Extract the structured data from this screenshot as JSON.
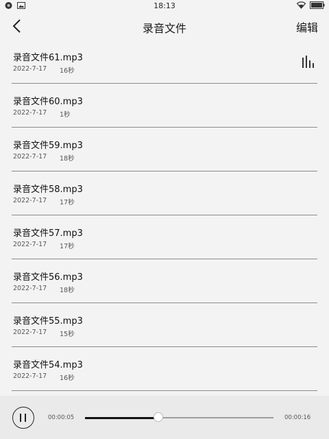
{
  "status_bar": {
    "time": "18:13"
  },
  "header": {
    "title": "录音文件",
    "edit_label": "编辑"
  },
  "recordings": [
    {
      "name": "录音文件61.mp3",
      "date": "2022-7-17",
      "duration": "16秒",
      "playing": true
    },
    {
      "name": "录音文件60.mp3",
      "date": "2022-7-17",
      "duration": "1秒",
      "playing": false
    },
    {
      "name": "录音文件59.mp3",
      "date": "2022-7-17",
      "duration": "18秒",
      "playing": false
    },
    {
      "name": "录音文件58.mp3",
      "date": "2022-7-17",
      "duration": "17秒",
      "playing": false
    },
    {
      "name": "录音文件57.mp3",
      "date": "2022-7-17",
      "duration": "17秒",
      "playing": false
    },
    {
      "name": "录音文件56.mp3",
      "date": "2022-7-17",
      "duration": "18秒",
      "playing": false
    },
    {
      "name": "录音文件55.mp3",
      "date": "2022-7-17",
      "duration": "15秒",
      "playing": false
    },
    {
      "name": "录音文件54.mp3",
      "date": "2022-7-17",
      "duration": "16秒",
      "playing": false
    }
  ],
  "player": {
    "current_time": "00:00:05",
    "total_time": "00:00:16",
    "progress": 0.39,
    "state": "playing"
  },
  "icons": {
    "back": "chevron-left-icon",
    "playing": "equalizer-icon",
    "pause": "pause-icon",
    "wifi": "wifi-icon",
    "battery": "battery-icon"
  }
}
